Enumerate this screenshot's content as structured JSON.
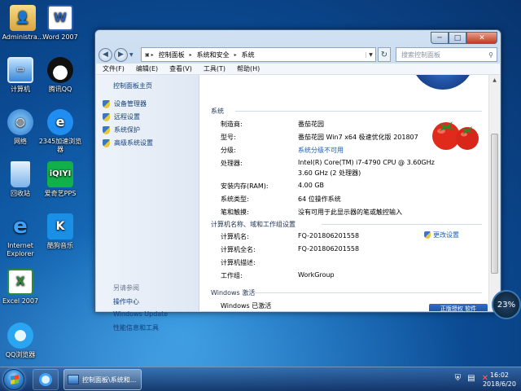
{
  "desktop": {
    "icons": [
      {
        "label": "Administra...",
        "icon": "user-folder-icon",
        "color": "#e8c560"
      },
      {
        "label": "Word 2007",
        "icon": "word-icon",
        "color": "#2b5fb3"
      },
      {
        "label": "计算机",
        "icon": "computer-icon",
        "color": "#3a87d8"
      },
      {
        "label": "腾讯QQ",
        "icon": "qq-penguin-icon",
        "color": "#1b1b1b"
      },
      {
        "label": "网络",
        "icon": "network-icon",
        "color": "#3a87d8"
      },
      {
        "label": "2345加速浏览器",
        "icon": "browser-2345-icon",
        "color": "#1f8ef0"
      },
      {
        "label": "回收站",
        "icon": "recycle-bin-icon",
        "color": "#7db3e8"
      },
      {
        "label": "爱奇艺PPS",
        "icon": "iqiyi-icon",
        "color": "#12b04a"
      },
      {
        "label": "Internet Explorer",
        "icon": "ie-icon",
        "color": "#2f9ff0"
      },
      {
        "label": "酷狗音乐",
        "icon": "kugou-icon",
        "color": "#1a8fe6"
      },
      {
        "label": "Excel 2007",
        "icon": "excel-icon",
        "color": "#2f8a3a"
      },
      {
        "label": "QQ浏览器",
        "icon": "qq-browser-icon",
        "color": "#2aa5f2"
      }
    ]
  },
  "window": {
    "address": {
      "items": [
        "控制面板",
        "系统和安全",
        "系统"
      ]
    },
    "search_placeholder": "搜索控制面板",
    "controls": {
      "minimize": "─",
      "maximize": "□",
      "close": "✕"
    },
    "menu": [
      "文件(F)",
      "编辑(E)",
      "查看(V)",
      "工具(T)",
      "帮助(H)"
    ],
    "sidebar": {
      "home": "控制面板主页",
      "links": [
        "设备管理器",
        "远程设置",
        "系统保护",
        "高级系统设置"
      ],
      "see_also": "另请参阅",
      "related": [
        "操作中心",
        "Windows Update",
        "性能信息和工具"
      ]
    },
    "system": {
      "title": "系统",
      "rows": [
        {
          "label": "制造商:",
          "value": "番茄花园"
        },
        {
          "label": "型号:",
          "value": "番茄花园 Win7 x64 极速优化版 201807"
        },
        {
          "label": "分级:",
          "value": "系统分级不可用"
        },
        {
          "label": "处理器:",
          "value": "Intel(R) Core(TM) i7-4790 CPU @ 3.60GHz",
          "value2": "3.60 GHz  (2 处理器)"
        },
        {
          "label": "安装内存(RAM):",
          "value": "4.00 GB"
        },
        {
          "label": "系统类型:",
          "value": "64 位操作系统"
        },
        {
          "label": "笔和触摸:",
          "value": "没有可用于此显示器的笔或触控输入"
        }
      ]
    },
    "computer": {
      "title": "计算机名称、域和工作组设置",
      "change_settings": "更改设置",
      "rows": [
        {
          "label": "计算机名:",
          "value": "FQ-201806201558"
        },
        {
          "label": "计算机全名:",
          "value": "FQ-201806201558"
        },
        {
          "label": "计算机描述:",
          "value": ""
        },
        {
          "label": "工作组:",
          "value": "WorkGroup"
        }
      ]
    },
    "activation": {
      "title": "Windows 激活",
      "status": "Windows 已激活",
      "badge": "正版授权 软件"
    }
  },
  "taskbar": {
    "task_label": "控制面板\\系统和...",
    "clock_time": "16:02",
    "clock_date": "2018/6/20"
  },
  "widget": {
    "label": "23%"
  }
}
